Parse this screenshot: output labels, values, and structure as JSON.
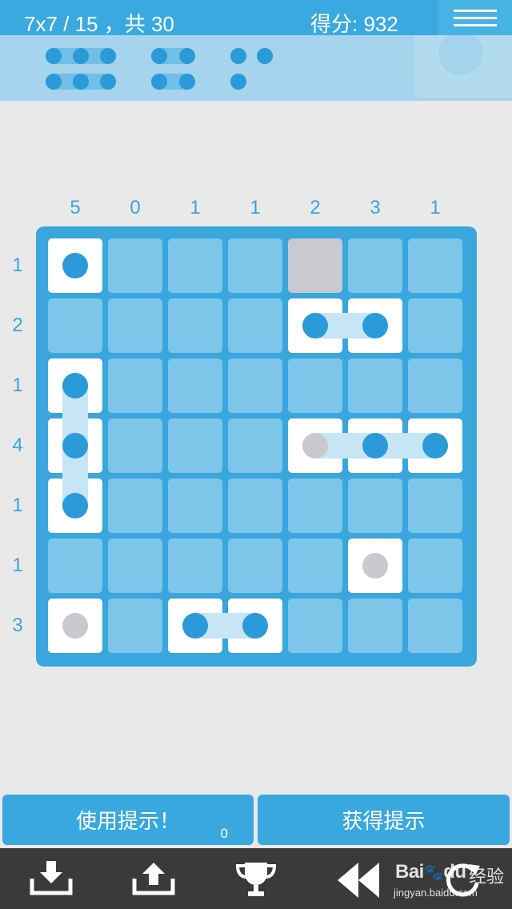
{
  "header": {
    "level": "7x7 / 15 ，共 30",
    "score": "得分: 932"
  },
  "column_clues": [
    "5",
    "0",
    "1",
    "1",
    "2",
    "3",
    "1"
  ],
  "row_clues": [
    "1",
    "2",
    "1",
    "4",
    "1",
    "1",
    "3"
  ],
  "board": {
    "size": 7,
    "white_cells": [
      [
        0,
        0
      ],
      [
        1,
        4
      ],
      [
        1,
        5
      ],
      [
        2,
        0
      ],
      [
        3,
        0
      ],
      [
        3,
        4
      ],
      [
        3,
        5
      ],
      [
        3,
        6
      ],
      [
        4,
        0
      ],
      [
        5,
        5
      ],
      [
        6,
        0
      ],
      [
        6,
        2
      ],
      [
        6,
        3
      ]
    ],
    "grey_cells": [
      [
        0,
        4
      ]
    ],
    "blue_discs": [
      [
        0,
        0
      ],
      [
        1,
        4
      ],
      [
        1,
        5
      ],
      [
        2,
        0
      ],
      [
        3,
        0
      ],
      [
        3,
        5
      ],
      [
        3,
        6
      ],
      [
        4,
        0
      ],
      [
        6,
        2
      ],
      [
        6,
        3
      ]
    ],
    "grey_discs": [
      [
        3,
        4
      ],
      [
        5,
        5
      ],
      [
        6,
        0
      ]
    ]
  },
  "buttons": {
    "use_hint": "使用提示！",
    "hint_count": "0",
    "get_hint": "获得提示"
  },
  "toolbar": {
    "icons": [
      "download-icon",
      "upload-icon",
      "trophy-icon",
      "rewind-icon",
      "restart-icon"
    ]
  },
  "watermark": {
    "brand": "Bai",
    "brand_suffix": "du",
    "cn": "经验",
    "url": "jingyan.baidu.com"
  },
  "colors": {
    "accent": "#39a6dd",
    "cell": "#7cc6ea",
    "disc": "#2a9bd8",
    "grey": "#cac9d0"
  }
}
